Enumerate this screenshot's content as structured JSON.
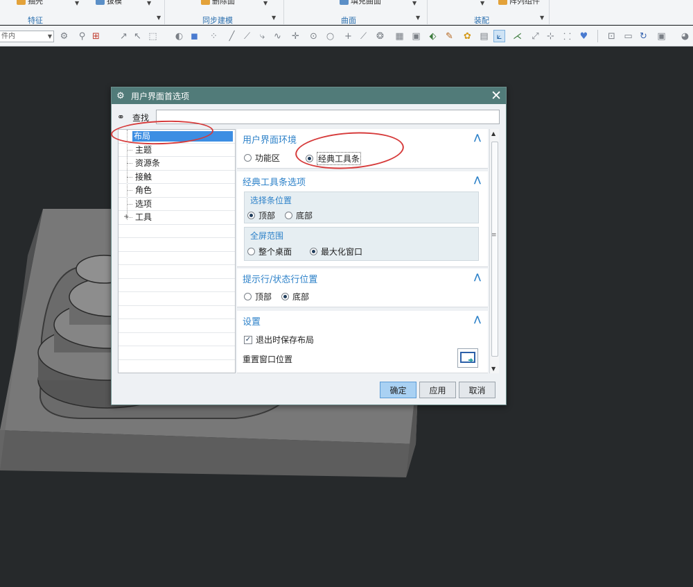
{
  "ribbon": {
    "groups": [
      {
        "label": "特征",
        "buttons": [
          "抽壳",
          "拔模"
        ]
      },
      {
        "label": "同步建模",
        "buttons": [
          "删除面"
        ]
      },
      {
        "label": "曲面",
        "buttons": [
          "填充曲面"
        ]
      },
      {
        "label": "装配",
        "buttons": [
          "阵列组件"
        ]
      }
    ]
  },
  "toolbar": {
    "selection_filter": "件内"
  },
  "dialog": {
    "title": "用户界面首选项",
    "close_glyph": "✕",
    "search_label": "查找",
    "search_value": "",
    "tree": {
      "items": [
        {
          "label": "布局",
          "selected": true
        },
        {
          "label": "主题"
        },
        {
          "label": "资源条"
        },
        {
          "label": "接触"
        },
        {
          "label": "角色"
        },
        {
          "label": "选项"
        },
        {
          "label": "工具",
          "expandable": true
        }
      ]
    },
    "sections": {
      "ui_env": {
        "title": "用户界面环境",
        "options": [
          "功能区",
          "经典工具条"
        ],
        "selected": "经典工具条"
      },
      "classic_options": {
        "title": "经典工具条选项",
        "select_bar_position": {
          "title": "选择条位置",
          "options": [
            "顶部",
            "底部"
          ],
          "selected": "顶部"
        },
        "fullscreen_range": {
          "title": "全屏范围",
          "options": [
            "整个桌面",
            "最大化窗口"
          ],
          "selected": "最大化窗口"
        }
      },
      "prompt_status": {
        "title": "提示行/状态行位置",
        "options": [
          "顶部",
          "底部"
        ],
        "selected": "底部"
      },
      "settings": {
        "title": "设置",
        "save_layout_label": "退出时保存布局",
        "save_layout_checked": true,
        "reset_window_label": "重置窗口位置"
      }
    },
    "buttons": {
      "ok": "确定",
      "apply": "应用",
      "cancel": "取消"
    }
  },
  "colors": {
    "titlebar": "#517b79",
    "accent": "#2e82c9",
    "selection": "#3c8ee3",
    "annotation": "#d63a3a",
    "viewport_bg": "#26292b"
  }
}
